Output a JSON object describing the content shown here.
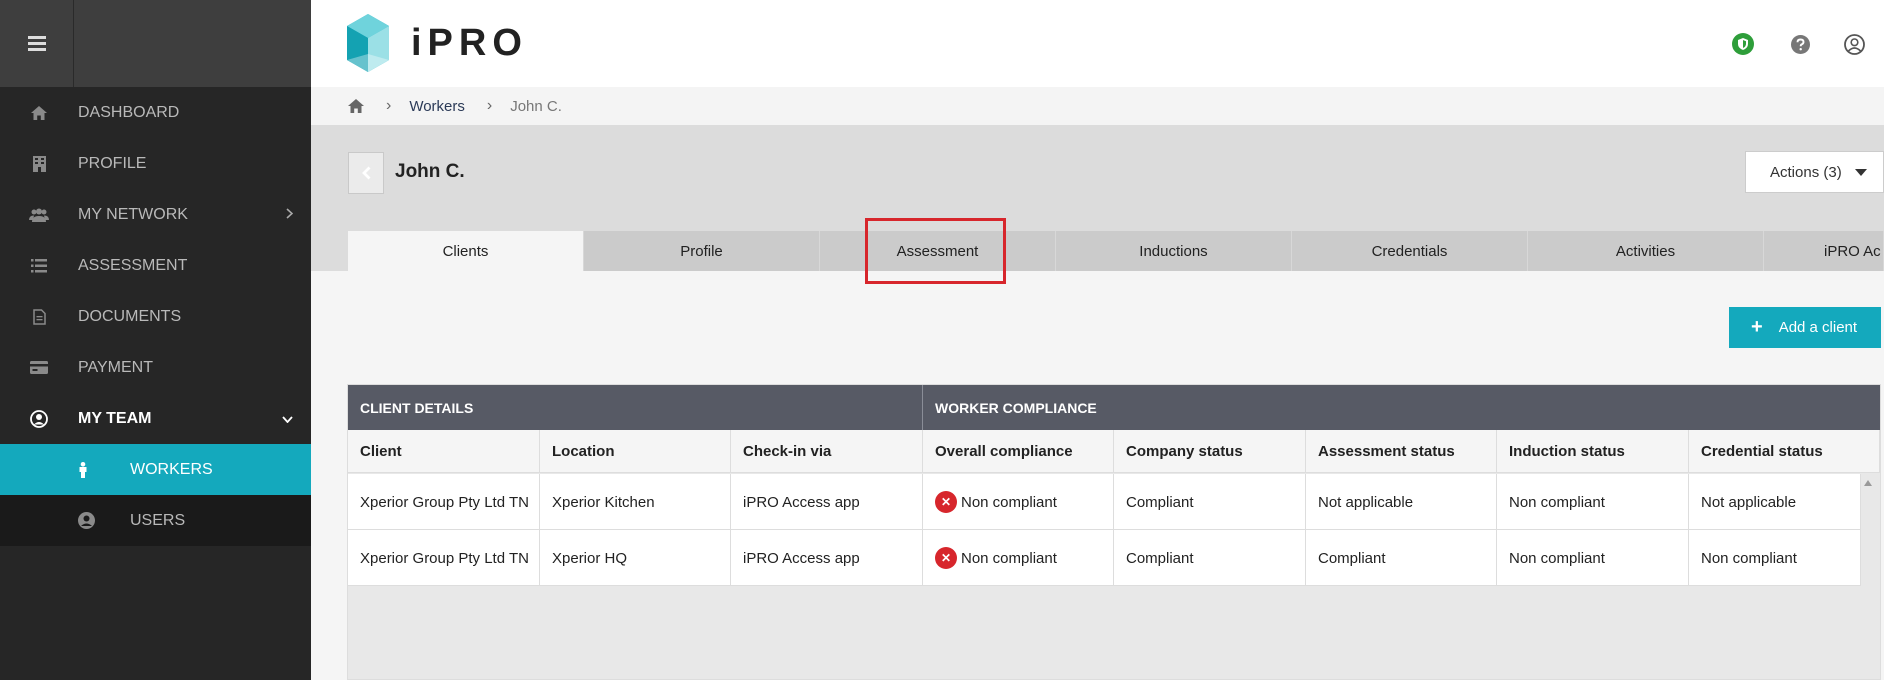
{
  "sidebar": {
    "items": [
      {
        "label": "DASHBOARD",
        "icon": "home-icon"
      },
      {
        "label": "PROFILE",
        "icon": "building-icon"
      },
      {
        "label": "MY NETWORK",
        "icon": "users-icon"
      },
      {
        "label": "ASSESSMENT",
        "icon": "list-icon"
      },
      {
        "label": "DOCUMENTS",
        "icon": "document-icon"
      },
      {
        "label": "PAYMENT",
        "icon": "credit-card-icon"
      },
      {
        "label": "MY TEAM",
        "icon": "user-circle-icon"
      }
    ],
    "subitems": [
      {
        "label": "WORKERS",
        "icon": "person-icon"
      },
      {
        "label": "USERS",
        "icon": "user-circle-icon"
      }
    ]
  },
  "header": {
    "logo_text": "iPRO",
    "icons": [
      "shield-icon",
      "help-icon",
      "account-icon"
    ]
  },
  "breadcrumb": {
    "home_icon": "home-icon",
    "workers": "Workers",
    "current": "John C."
  },
  "worker": {
    "name": "John C.",
    "actions_label": "Actions (3)"
  },
  "tabs": [
    "Clients",
    "Profile",
    "Assessment",
    "Inductions",
    "Credentials",
    "Activities",
    "iPRO Ac"
  ],
  "add_client_label": "Add a client",
  "table": {
    "group_headers": [
      "CLIENT DETAILS",
      "WORKER COMPLIANCE"
    ],
    "columns": [
      "Client",
      "Location",
      "Check-in via",
      "Overall compliance",
      "Company status",
      "Assessment status",
      "Induction status",
      "Credential status"
    ],
    "rows": [
      [
        "Xperior Group Pty Ltd TN",
        "Xperior Kitchen",
        "iPRO Access app",
        "Non compliant",
        "Compliant",
        "Not applicable",
        "Non compliant",
        "Not applicable"
      ],
      [
        "Xperior Group Pty Ltd TN",
        "Xperior HQ",
        "iPRO Access app",
        "Non compliant",
        "Compliant",
        "Compliant",
        "Non compliant",
        "Non compliant"
      ]
    ]
  },
  "colors": {
    "accent": "#14a9bd",
    "sidebar_bg": "#262626",
    "table_header_bg": "#575a65",
    "error": "#d7262c",
    "status_green": "#2e9e3a"
  }
}
